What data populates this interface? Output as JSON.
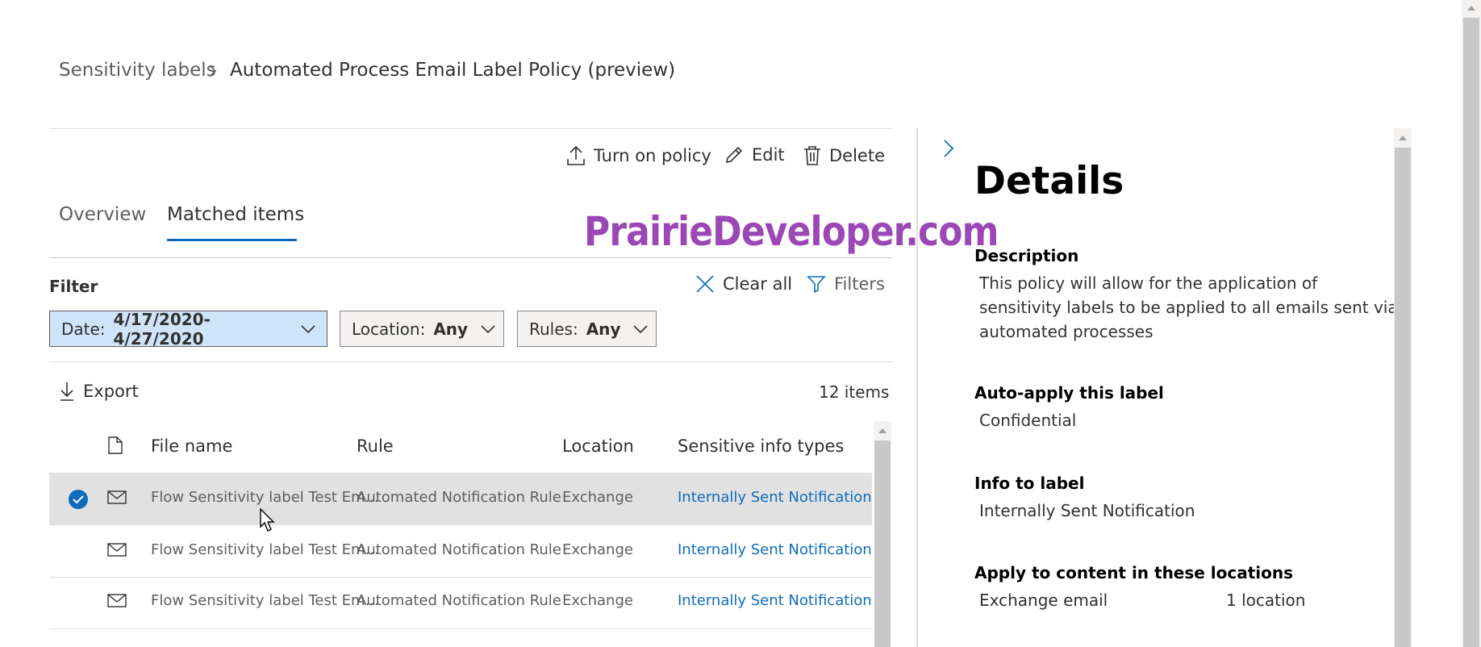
{
  "breadcrumb": {
    "root": "Sensitivity labels",
    "current": "Automated Process Email Label Policy (preview)"
  },
  "commands": {
    "turn_on": "Turn on policy",
    "edit": "Edit",
    "delete": "Delete"
  },
  "tabs": [
    {
      "label": "Overview",
      "active": false
    },
    {
      "label": "Matched items",
      "active": true
    }
  ],
  "watermark": "PrairieDeveloper.com",
  "filter": {
    "label": "Filter",
    "clear_all": "Clear all",
    "filters": "Filters",
    "date": {
      "label": "Date:",
      "value": "4/17/2020-4/27/2020"
    },
    "location": {
      "label": "Location:",
      "value": "Any"
    },
    "rules": {
      "label": "Rules:",
      "value": "Any"
    }
  },
  "toolbar": {
    "export": "Export",
    "items_count": "12 items"
  },
  "table": {
    "columns": [
      "File name",
      "Rule",
      "Location",
      "Sensitive info types"
    ],
    "rows": [
      {
        "file": "Flow Sensitivity label Test Em...",
        "rule": "Automated Notification Rule",
        "location": "Exchange",
        "types": "Internally Sent Notification",
        "selected": true
      },
      {
        "file": "Flow Sensitivity label Test Em...",
        "rule": "Automated Notification Rule",
        "location": "Exchange",
        "types": "Internally Sent Notification",
        "selected": false
      },
      {
        "file": "Flow Sensitivity label Test Em...",
        "rule": "Automated Notification Rule",
        "location": "Exchange",
        "types": "Internally Sent Notification",
        "selected": false
      }
    ]
  },
  "details": {
    "title": "Details",
    "description_label": "Description",
    "description_lines": [
      "This policy will allow for the application of",
      "sensitivity labels to be applied to all emails sent via",
      "automated processes"
    ],
    "auto_apply_label": "Auto-apply this label",
    "auto_apply_value": "Confidential",
    "info_label": "Info to label",
    "info_value": "Internally Sent Notification",
    "locations_label": "Apply to content in these locations",
    "locations_name": "Exchange email",
    "locations_count": "1 location"
  },
  "colors": {
    "accent": "#0f6cbd",
    "selected_filter": "#cfe4fa",
    "watermark": "#9b47b5"
  }
}
